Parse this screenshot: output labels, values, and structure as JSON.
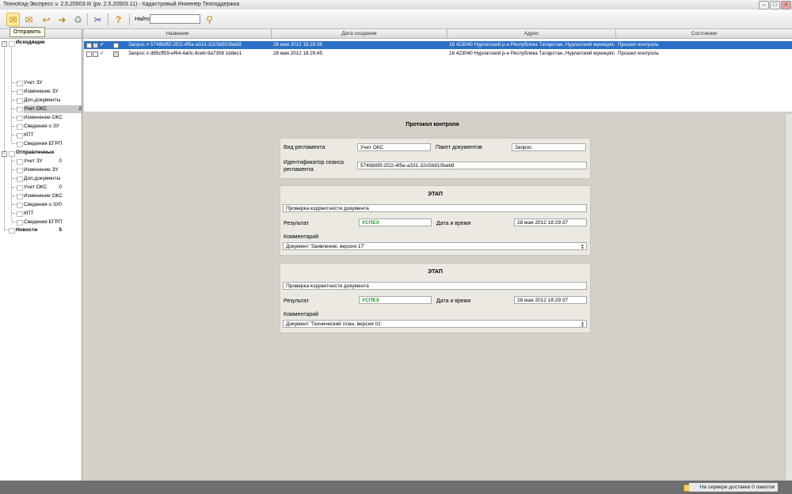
{
  "window": {
    "title": "ТехноКад-Экспресс v. 2.5.20503.0r (pv. 2.5.20503.11) - Кадастровый Инженер Техподдержка",
    "controls": [
      "–",
      "□",
      "×"
    ]
  },
  "toolbar": {
    "buttons": [
      {
        "name": "send-icon",
        "glyph": "✉"
      },
      {
        "name": "receive-icon",
        "glyph": "✉"
      },
      {
        "name": "reply-icon",
        "glyph": "↩"
      },
      {
        "name": "forward-icon",
        "glyph": "➜"
      },
      {
        "name": "recycle-icon",
        "glyph": "♻"
      },
      {
        "name": "settings-icon",
        "glyph": "✂"
      },
      {
        "name": "help-icon",
        "glyph": "?"
      },
      {
        "name": "search-go-icon",
        "glyph": "⚲"
      }
    ],
    "tooltip": "Отправить",
    "search_label": "Найти",
    "search_value": ""
  },
  "tree": {
    "groups": [
      {
        "label": "Исходящие",
        "count": "",
        "items": [
          {
            "label": "Учет ЗУ",
            "count": ""
          },
          {
            "label": "Изменение ЗУ",
            "count": ""
          },
          {
            "label": "Доп.документы",
            "count": ""
          },
          {
            "label": "Учет ОКС",
            "count": "2",
            "selected": true
          },
          {
            "label": "Изменение ОКС",
            "count": ""
          },
          {
            "label": "Сведения о ЗУ",
            "count": ""
          },
          {
            "label": "КПТ",
            "count": ""
          },
          {
            "label": "Сведения ЕГРП",
            "count": ""
          }
        ]
      },
      {
        "label": "Отправленные",
        "count": "",
        "items": [
          {
            "label": "Учет ЗУ",
            "count": "0"
          },
          {
            "label": "Изменение ЗУ",
            "count": ""
          },
          {
            "label": "Доп.документы",
            "count": ""
          },
          {
            "label": "Учет ОКС",
            "count": "0"
          },
          {
            "label": "Изменение ОКС",
            "count": ""
          },
          {
            "label": "Сведения о ЗУ",
            "count": "0"
          },
          {
            "label": "КПТ",
            "count": ""
          },
          {
            "label": "Сведения ЕГРП",
            "count": ""
          }
        ]
      },
      {
        "label": "Новости",
        "count": "5",
        "items": []
      }
    ]
  },
  "grid": {
    "columns": [
      "Название",
      "Дата создания",
      "Адрес",
      "Состояние"
    ],
    "rows": [
      {
        "name": "Запрос # 5749b95f-2f22-4f5e-a331-32c5b910beb9",
        "date": "28 мая 2012 18:29:36",
        "address": "16 423040 Нурлатский р-н Республика Татарстан, Нурлатский муниципаль...",
        "state": "Прошел контроль",
        "selected": true
      },
      {
        "name": "Запрос # d85cff59-ef64-4a0c-8ceb-9a7308 1ddec1",
        "date": "28 мая 2012 18:29:45",
        "address": "16 423040 Нурлатский р-н Республика Татарстан, Нурлатский муниципаль...",
        "state": "Прошел контроль",
        "selected": false
      }
    ]
  },
  "protocol": {
    "title": "Протокол контроля",
    "header": {
      "reg_type_label": "Вид регламента",
      "reg_type_value": "Учет ОКС",
      "package_label": "Пакет документов",
      "package_value": "Запрос",
      "session_label": "Идентификатор сеанса регламента",
      "session_value": "5749b95f-2f22-4f5e-a331-32c5b910beb9"
    },
    "stages": [
      {
        "title": "ЭТАП",
        "name": "Проверка корректности документа",
        "result_label": "Результат",
        "result_value": "УСПЕХ",
        "datetime_label": "Дата и время",
        "datetime_value": "28 мая 2012 18:29:37",
        "comment_label": "Комментарий",
        "comment_value": "Документ 'Заявление, версия 17'"
      },
      {
        "title": "ЭТАП",
        "name": "Проверка корректности документа",
        "result_label": "Результат",
        "result_value": "УСПЕХ",
        "datetime_label": "Дата и время",
        "datetime_value": "28 мая 2012 18:29:37",
        "comment_label": "Комментарий",
        "comment_value": "Документ 'Технический план, версия 01'"
      }
    ]
  },
  "status": {
    "text": "На сервере доставки 0 пакетов"
  },
  "colors": {
    "selection": "#2b6fc6",
    "success": "#1e9a2c",
    "panel": "#d4d0c8"
  }
}
